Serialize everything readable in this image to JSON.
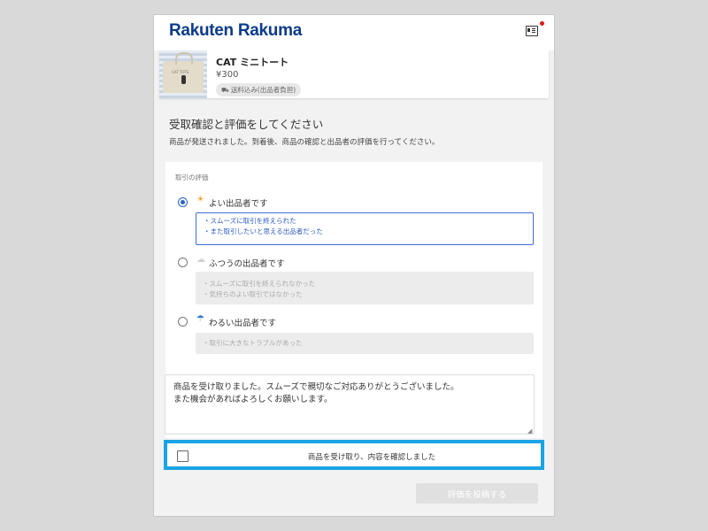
{
  "header": {
    "logo": "Rakuten Rakuma",
    "card_icon": "member-card-icon",
    "notification_color": "#e0171c"
  },
  "product": {
    "name": "CAT ミニトート",
    "price": "¥300",
    "shipping_badge": "送料込み(出品者負担)",
    "shipping_icon": "truck-icon",
    "thumb_text": "CAT TOTE"
  },
  "page": {
    "title": "受取確認と評価をしてください",
    "subtitle": "商品が発送されました。到着後、商品の確認と出品者の評価を行ってください。"
  },
  "evaluation": {
    "section_label": "取引の評価",
    "options": [
      {
        "icon": "☀",
        "icon_name": "sun-icon",
        "label": "よい出品者です",
        "selected": true,
        "desc": [
          "・スムーズに取引を終えられた",
          "・また取引したいと思える出品者だった"
        ]
      },
      {
        "icon": "☁",
        "icon_name": "cloud-icon",
        "label": "ふつうの出品者です",
        "selected": false,
        "desc": [
          "・スムーズに取引を終えられなかった",
          "・気持ちのよい取引ではなかった"
        ]
      },
      {
        "icon": "☂",
        "icon_name": "umbrella-icon",
        "label": "わるい出品者です",
        "selected": false,
        "desc": [
          "・取引に大きなトラブルがあった"
        ]
      }
    ],
    "comment": "商品を受け取りました。スムーズで親切なご対応ありがとうございました。\nまた機会があればよろしくお願いします。"
  },
  "confirm": {
    "label": "商品を受け取り、内容を確認しました",
    "checked": false,
    "highlight_color": "#1aa4e4"
  },
  "submit": {
    "label": "評価を投稿する",
    "enabled": false
  },
  "colors": {
    "brand": "#0b3b8a",
    "accent_blue": "#2a62c7",
    "sun": "#f39a1a",
    "cloud": "#d0d0d0",
    "umbrella": "#2d7bd6"
  }
}
